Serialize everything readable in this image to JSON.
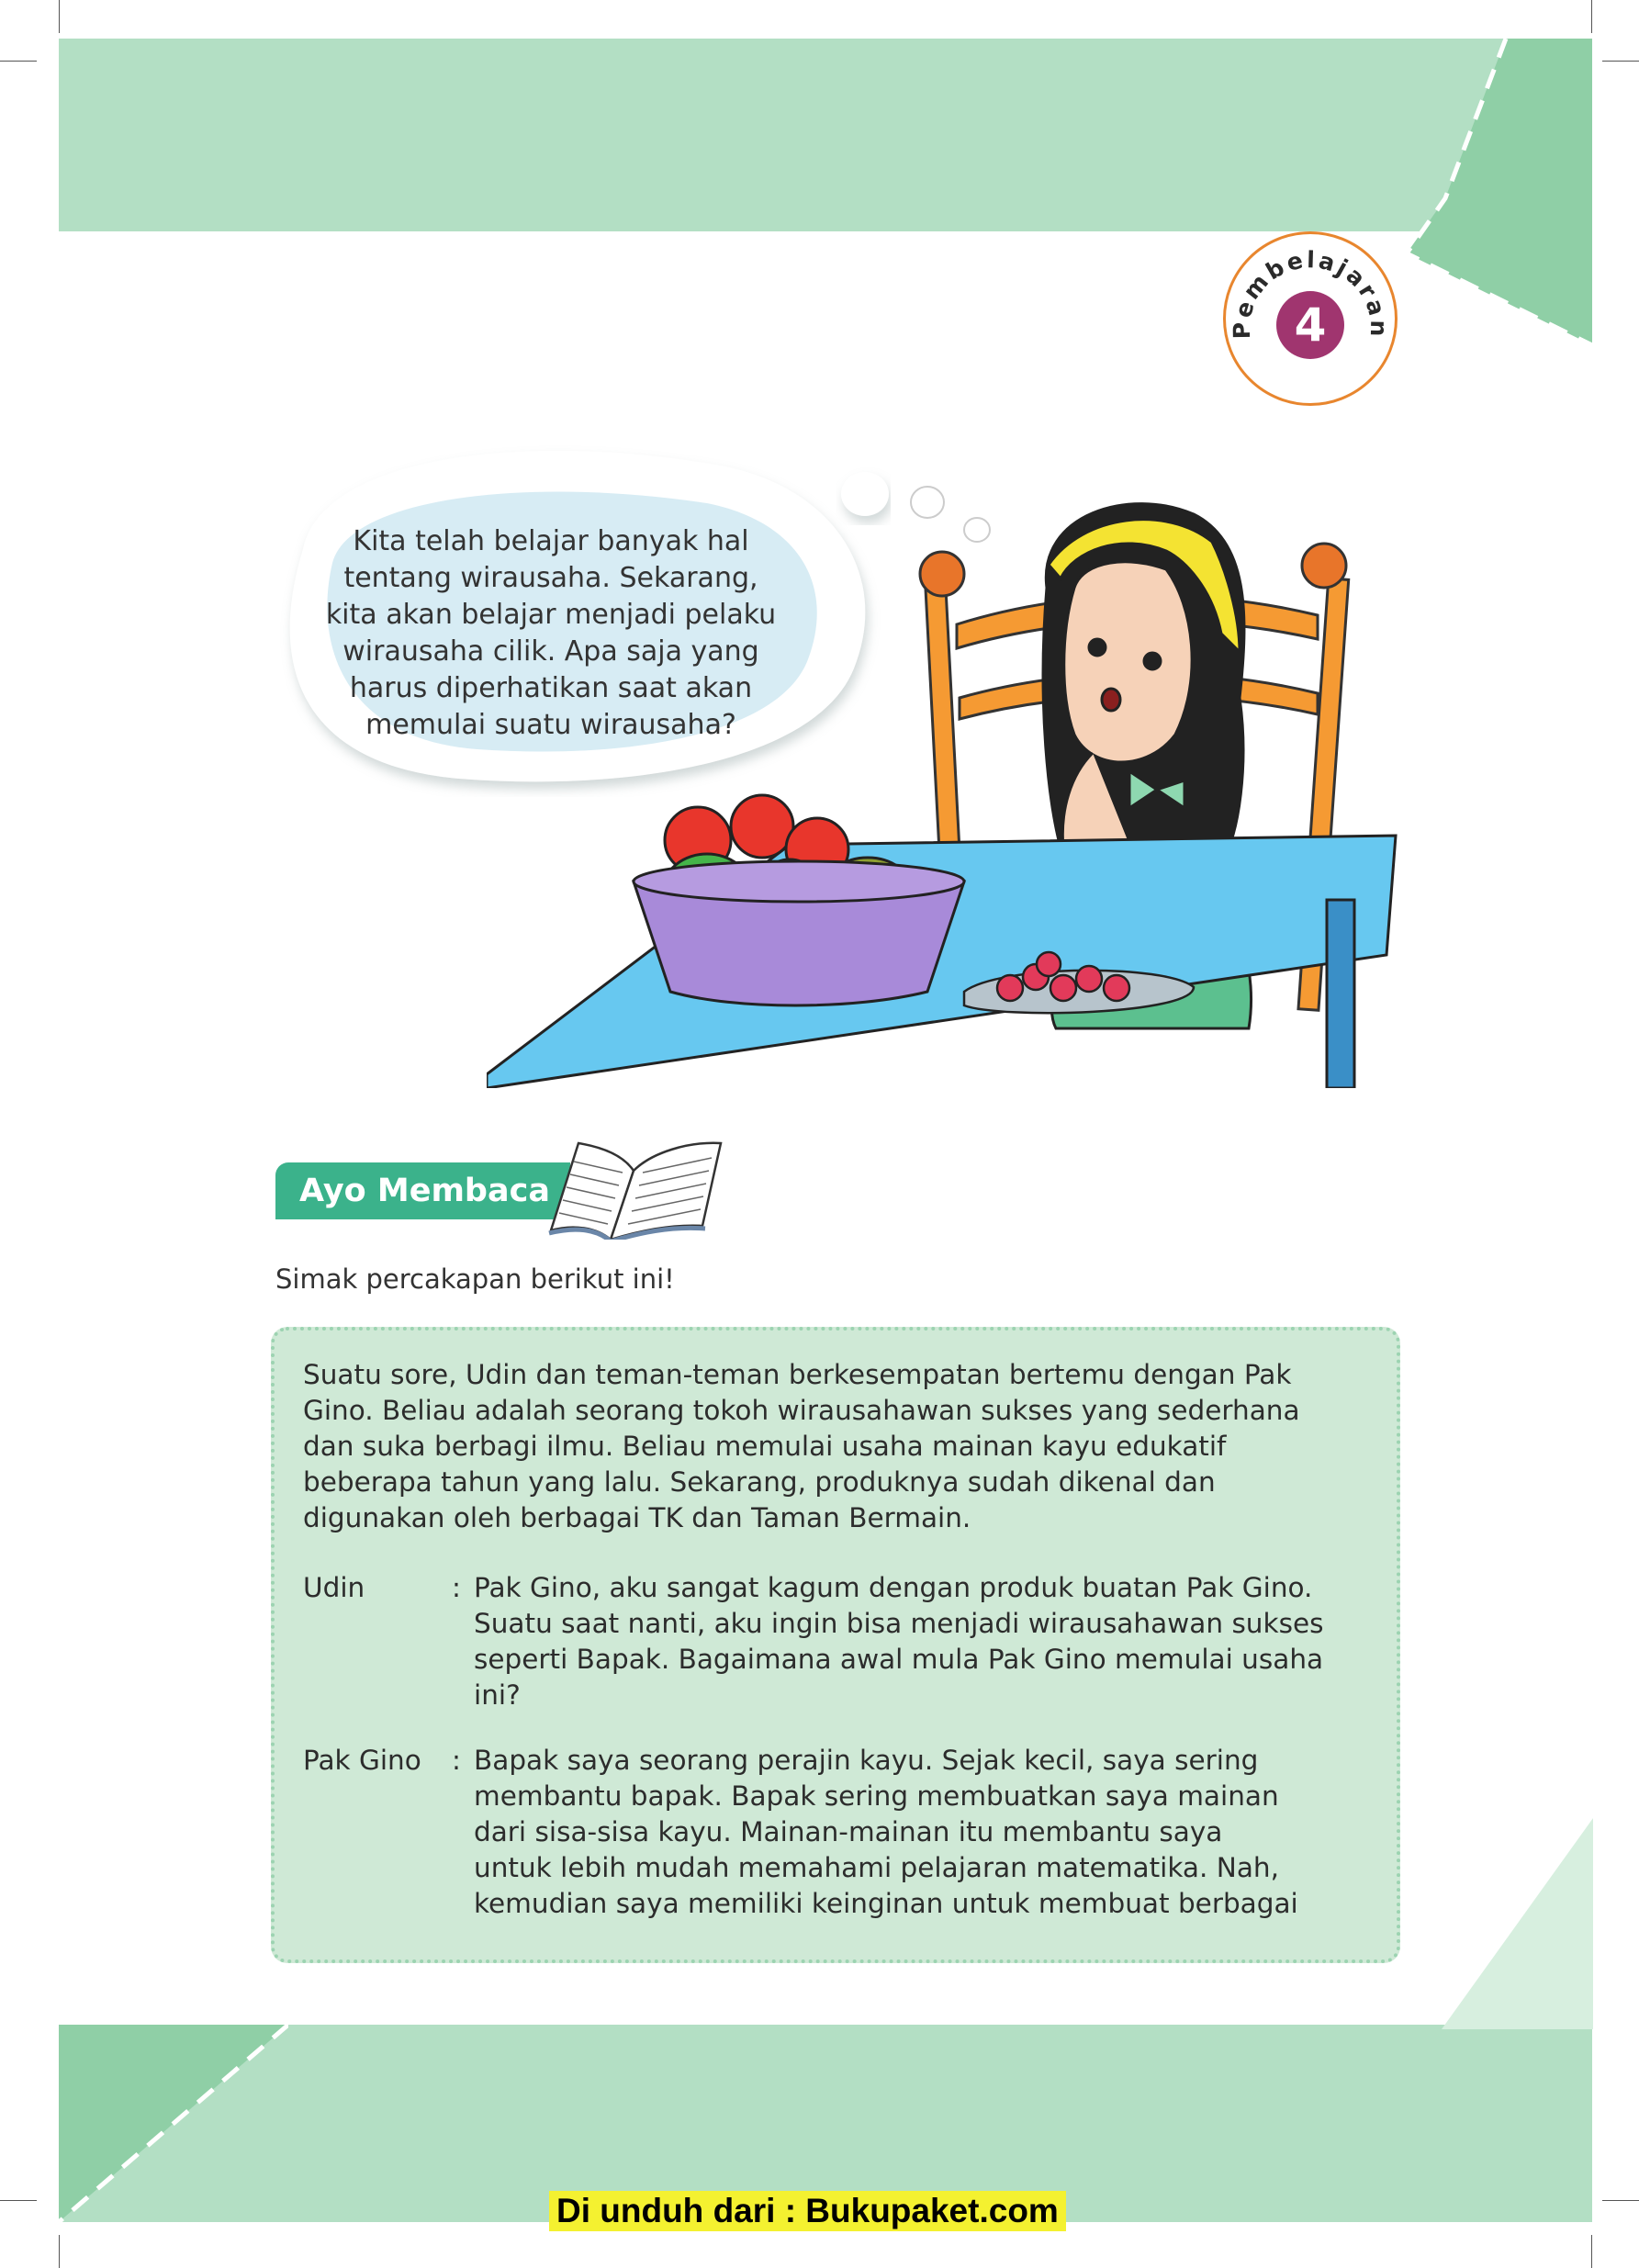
{
  "lesson_badge": {
    "label": "Pembelajaran",
    "number": "4"
  },
  "speech_bubble": {
    "lines": [
      "Kita telah belajar banyak hal",
      "tentang wirausaha. Sekarang,",
      "kita akan belajar menjadi pelaku",
      "wirausaha cilik. Apa saja yang",
      "harus diperhatikan saat akan",
      "memulai suatu wirausaha?"
    ]
  },
  "section": {
    "title": "Ayo Membaca",
    "instruction": "Simak  percakapan berikut  ini!"
  },
  "reading_box": {
    "intro_lines": [
      "Suatu sore, Udin dan teman-teman berkesempatan bertemu dengan Pak",
      "Gino. Beliau adalah seorang tokoh wirausahawan sukses yang sederhana",
      "dan suka  berbagi ilmu. Beliau memulai usaha mainan kayu edukatif",
      "beberapa tahun yang lalu. Sekarang, produknya sudah dikenal dan",
      "digunakan oleh berbagai  TK dan Taman Bermain."
    ],
    "dialogue": [
      {
        "speaker": "Udin",
        "lines": [
          "Pak Gino, aku sangat kagum dengan produk buatan Pak Gino.",
          "Suatu saat nanti, aku ingin bisa menjadi wirausahawan sukses",
          "seperti Bapak. Bagaimana awal mula Pak Gino memulai usaha",
          "ini?"
        ]
      },
      {
        "speaker": "Pak Gino",
        "lines": [
          "Bapak saya seorang perajin kayu. Sejak kecil, saya sering",
          "membantu bapak. Bapak  sering membuatkan saya mainan",
          "dari sisa-sisa kayu. Mainan-mainan itu membantu saya",
          "untuk  lebih mudah memahami pelajaran matematika. Nah,",
          "kemudian saya memiliki keinginan untuk membuat berbagai"
        ]
      }
    ]
  },
  "footer": {
    "text": "Di unduh dari : Bukupaket.com"
  },
  "colors": {
    "band": "#b3dfc4",
    "accent_green": "#3bb28b",
    "badge_purple": "#a0356f",
    "badge_ring": "#e8862e",
    "table_blue": "#67c8f0"
  },
  "icons": [
    "open-book-icon"
  ]
}
